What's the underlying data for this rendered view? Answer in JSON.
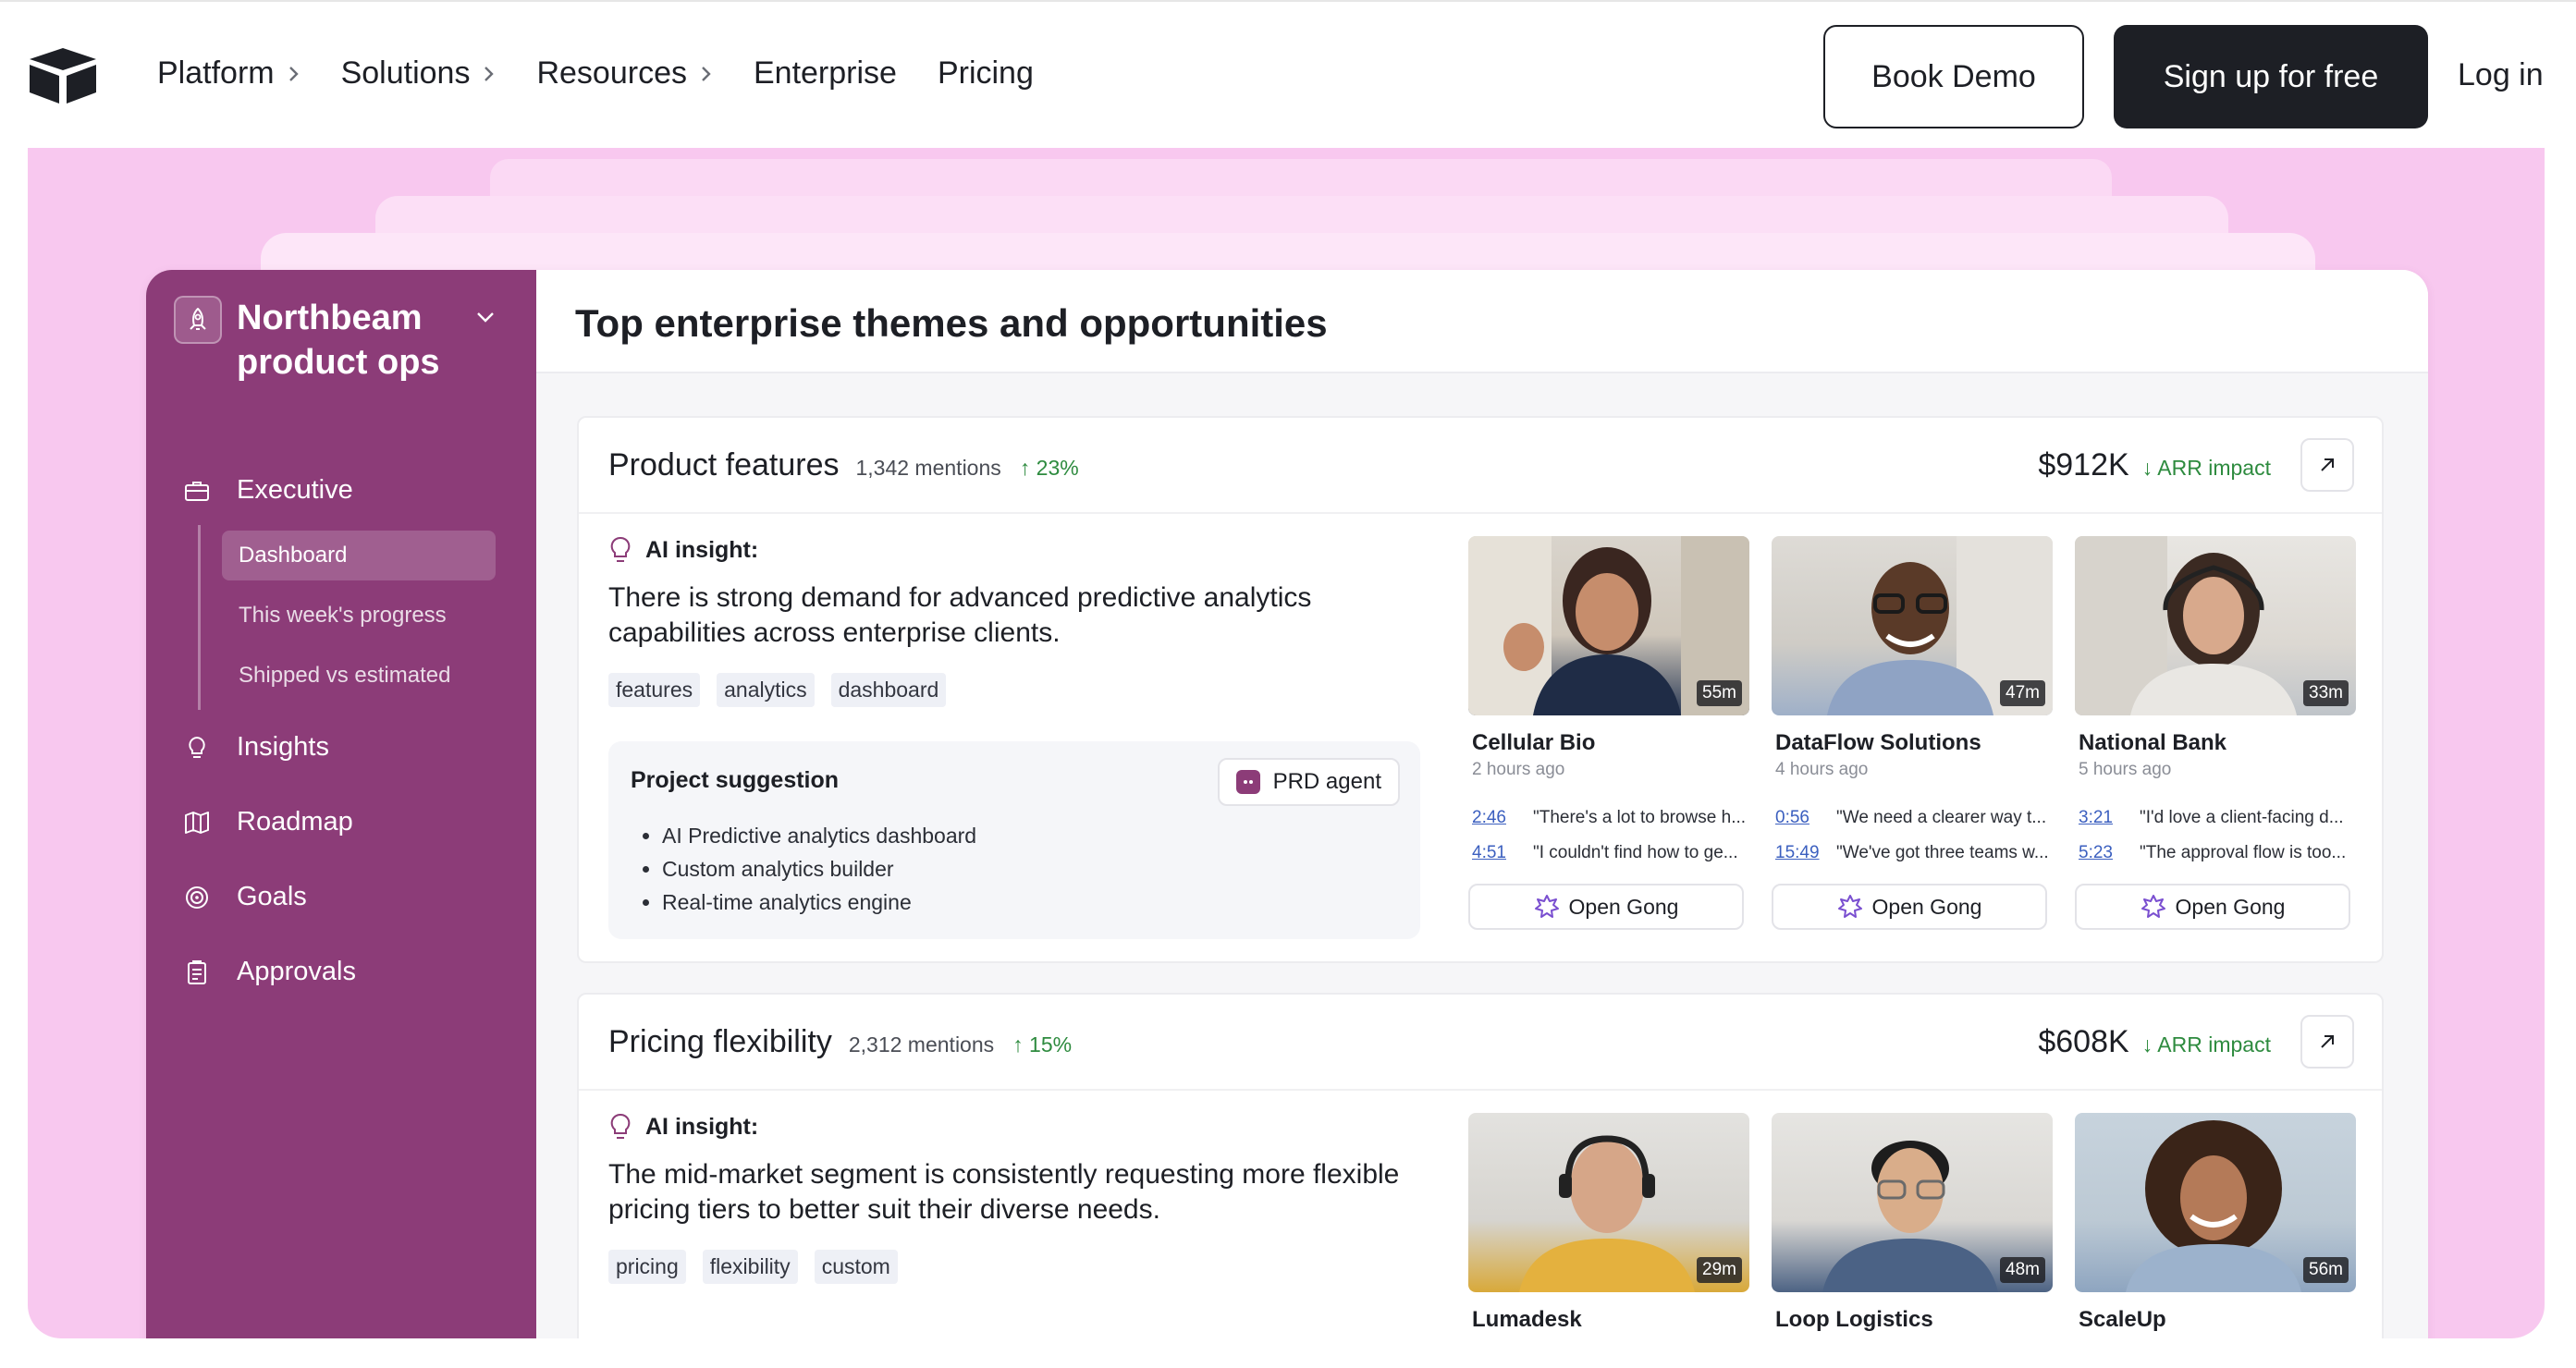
{
  "nav": {
    "links": [
      {
        "label": "Platform",
        "chevron": true
      },
      {
        "label": "Solutions",
        "chevron": true
      },
      {
        "label": "Resources",
        "chevron": true
      },
      {
        "label": "Enterprise",
        "chevron": false
      },
      {
        "label": "Pricing",
        "chevron": false
      }
    ],
    "book_demo": "Book Demo",
    "sign_up": "Sign up for free",
    "log_in": "Log in"
  },
  "sidebar": {
    "workspace": "Northbeam product ops",
    "sections": [
      {
        "label": "Executive",
        "icon": "briefcase-icon"
      },
      {
        "label": "Insights",
        "icon": "lightbulb-icon"
      },
      {
        "label": "Roadmap",
        "icon": "map-icon"
      },
      {
        "label": "Goals",
        "icon": "target-icon"
      },
      {
        "label": "Approvals",
        "icon": "clipboard-icon"
      }
    ],
    "executive_sub": [
      "Dashboard",
      "This week's progress",
      "Shipped vs estimated"
    ]
  },
  "main": {
    "title": "Top enterprise themes and opportunities",
    "themes": [
      {
        "title": "Product features",
        "mentions": "1,342 mentions",
        "trend": "23%",
        "arr": "$912K",
        "arr_label": "ARR impact",
        "insight_label": "AI insight:",
        "insight": "There is strong demand for advanced predictive analytics capabilities across enterprise clients.",
        "tags": [
          "features",
          "analytics",
          "dashboard"
        ],
        "project_title": "Project suggestion",
        "agent": "PRD agent",
        "projects": [
          "AI Predictive analytics dashboard",
          "Custom analytics builder",
          "Real-time analytics engine"
        ],
        "calls": [
          {
            "name": "Cellular Bio",
            "time": "2 hours ago",
            "duration": "55m",
            "quotes": [
              {
                "t": "2:46",
                "q": "\"There's a lot to browse h..."
              },
              {
                "t": "4:51",
                "q": "\"I couldn't find how to ge..."
              }
            ]
          },
          {
            "name": "DataFlow Solutions",
            "time": "4 hours ago",
            "duration": "47m",
            "quotes": [
              {
                "t": "0:56",
                "q": "\"We need a clearer way t..."
              },
              {
                "t": "15:49",
                "q": "\"We've got three teams w..."
              }
            ]
          },
          {
            "name": "National Bank",
            "time": "5 hours ago",
            "duration": "33m",
            "quotes": [
              {
                "t": "3:21",
                "q": "\"I'd love a client-facing d..."
              },
              {
                "t": "5:23",
                "q": "\"The approval flow is too..."
              }
            ]
          }
        ],
        "gong_label": "Open Gong"
      },
      {
        "title": "Pricing flexibility",
        "mentions": "2,312 mentions",
        "trend": "15%",
        "arr": "$608K",
        "arr_label": "ARR impact",
        "insight_label": "AI insight:",
        "insight": "The mid-market segment is consistently requesting more flexible pricing tiers to better suit their diverse needs.",
        "tags": [
          "pricing",
          "flexibility",
          "custom"
        ],
        "calls": [
          {
            "name": "Lumadesk",
            "duration": "29m"
          },
          {
            "name": "Loop Logistics",
            "duration": "48m"
          },
          {
            "name": "ScaleUp",
            "duration": "56m"
          }
        ]
      }
    ]
  },
  "colors": {
    "sidebar": "#8c3c78",
    "hero": "#f8c8ef",
    "dark": "#1d1f25",
    "trend_green": "#2e8b3f"
  }
}
